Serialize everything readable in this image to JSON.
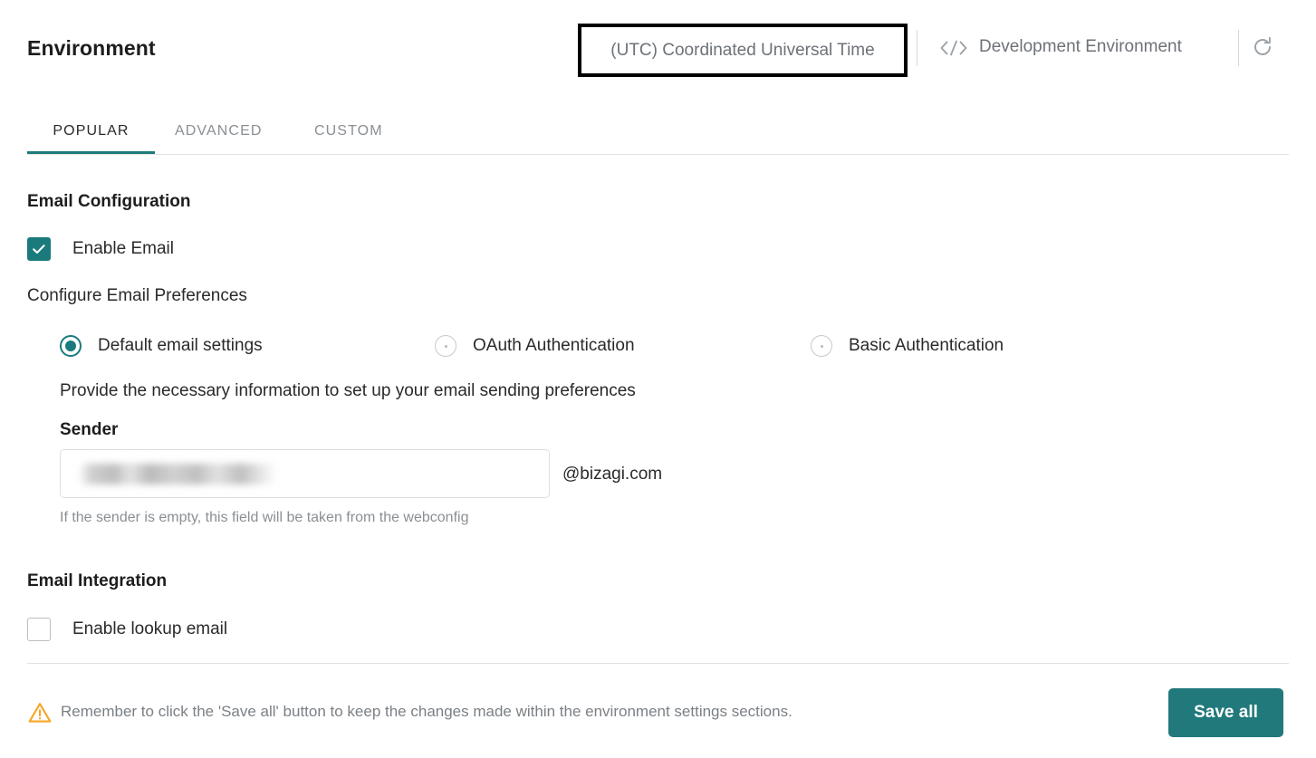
{
  "header": {
    "title": "Environment",
    "timezone": "(UTC) Coordinated Universal Time",
    "environment_name": "Development Environment",
    "code_icon": "code-icon",
    "refresh_icon": "refresh-icon",
    "accent_color": "#1f7a7c",
    "focus_outline_color": "#000000"
  },
  "tabs": [
    {
      "label": "POPULAR",
      "active": true
    },
    {
      "label": "ADVANCED",
      "active": false
    },
    {
      "label": "CUSTOM",
      "active": false
    }
  ],
  "sections": {
    "email_configuration": {
      "title": "Email Configuration",
      "enable_email": {
        "label": "Enable Email",
        "checked": true
      },
      "subhead": "Configure Email Preferences",
      "auth_options": [
        {
          "label": "Default email settings",
          "selected": true
        },
        {
          "label": "OAuth Authentication",
          "selected": false
        },
        {
          "label": "Basic Authentication",
          "selected": false
        }
      ],
      "helper_text": "Provide the necessary information to set up your email sending preferences",
      "sender": {
        "label": "Sender",
        "value": "",
        "placeholder": "",
        "redacted": true,
        "domain_suffix": "@bizagi.com",
        "hint": "If the sender is empty, this field will be taken from the webconfig"
      }
    },
    "email_integration": {
      "title": "Email Integration",
      "enable_lookup_email": {
        "label": "Enable lookup email",
        "checked": false
      }
    }
  },
  "footer": {
    "warning_icon": "warning-triangle-icon",
    "warning_color": "#F5A623",
    "warning_text": "Remember to click the 'Save all' button to keep the changes made within the environment settings sections.",
    "save_label": "Save all",
    "save_color": "#21797b"
  }
}
